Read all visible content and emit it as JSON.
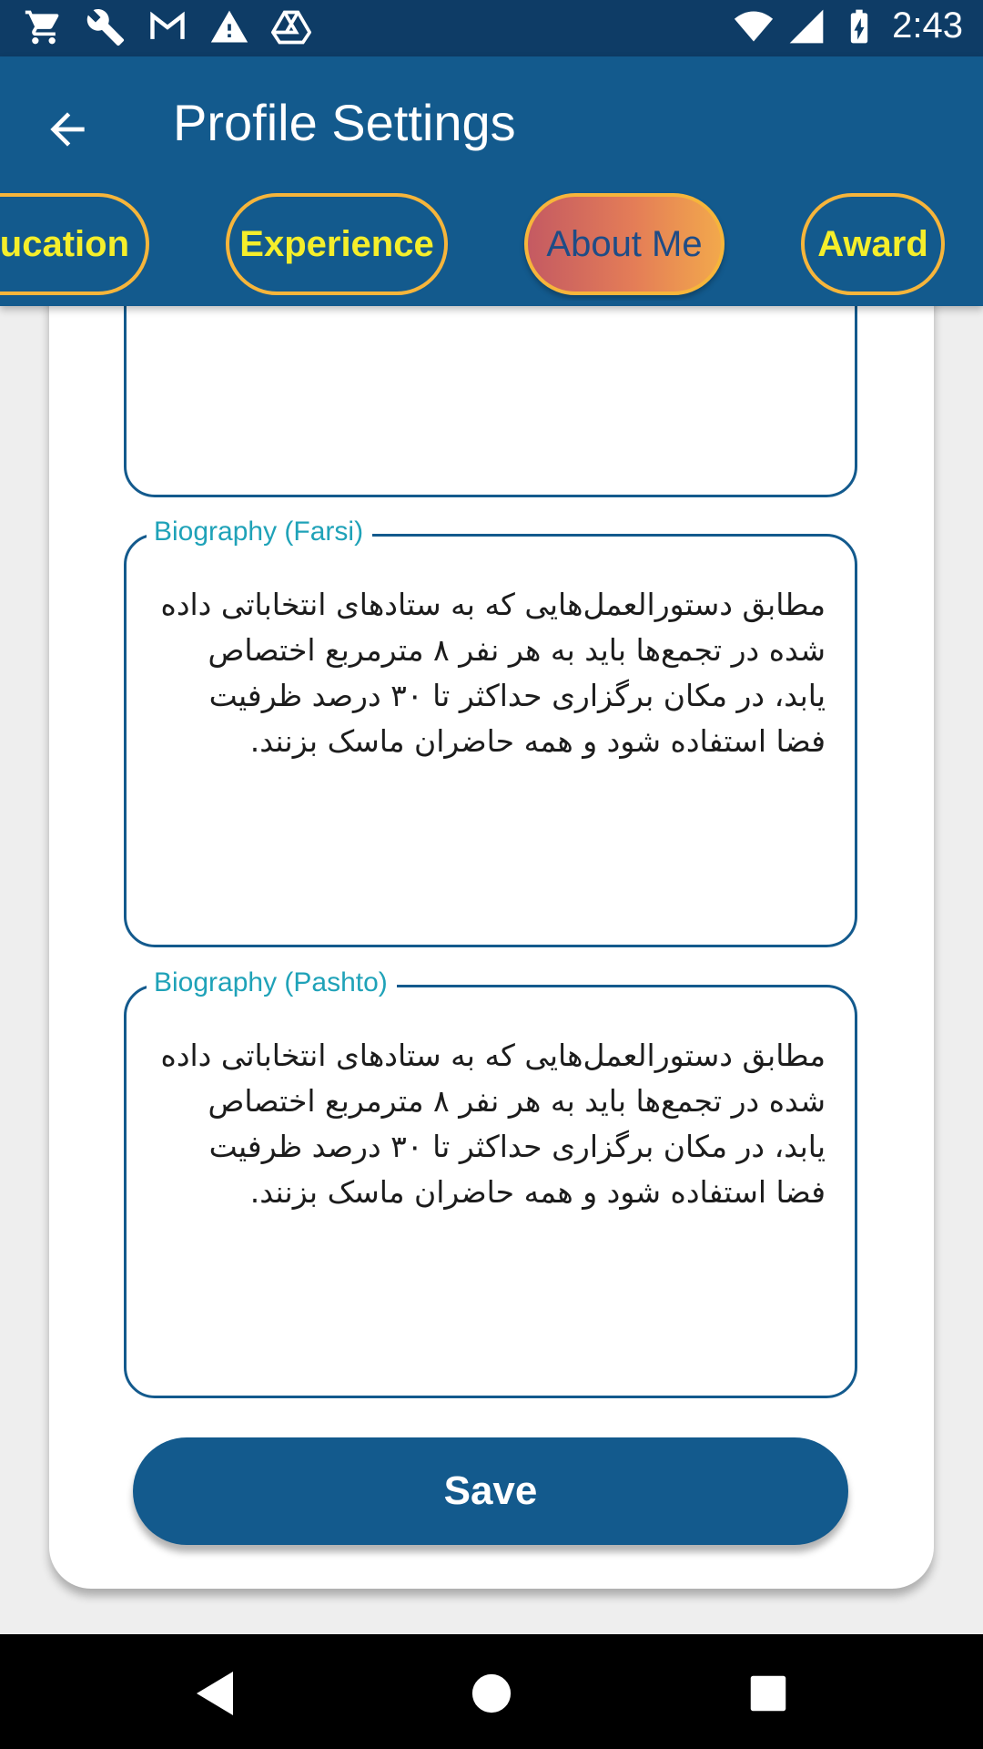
{
  "status_bar": {
    "time": "2:43",
    "notification_icons": [
      "cart-icon",
      "wrench-icon",
      "gmail-icon",
      "warning-icon",
      "drive-icon"
    ],
    "system_icons": [
      "wifi-icon",
      "signal-icon",
      "battery-charging-icon"
    ]
  },
  "app_bar": {
    "title": "Profile Settings",
    "back_icon": "arrow-left-icon",
    "background_color": "#135a8d"
  },
  "tabs": [
    {
      "label": "Education",
      "visible_text": "lucation",
      "active": false
    },
    {
      "label": "Experience",
      "active": false
    },
    {
      "label": "About Me",
      "active": true
    },
    {
      "label": "Award",
      "active": false
    }
  ],
  "form": {
    "fields": [
      {
        "label": "",
        "value": ""
      },
      {
        "label": "Biography (Farsi)",
        "value": "مطابق دستورالعمل‌هایی که به ستادهای انتخاباتی داده شده در تجمع‌ها باید به هر نفر ۸ مترمربع اختصاص یابد، در مکان برگزاری حداکثر تا ۳۰ درصد ظرفیت فضا استفاده شود و همه حاضران ماسک بزنند."
      },
      {
        "label": "Biography (Pashto)",
        "value": "مطابق دستورالعمل‌هایی که به ستادهای انتخاباتی داده شده در تجمع‌ها باید به هر نفر ۸ مترمربع اختصاص یابد، در مکان برگزاری حداکثر تا ۳۰ درصد ظرفیت فضا استفاده شود و همه حاضران ماسک بزنند."
      }
    ],
    "save_label": "Save"
  },
  "colors": {
    "primary": "#135a8d",
    "status_bar": "#0e3c66",
    "tab_border": "#f6b53b",
    "tab_text": "#f5ee2b",
    "label": "#1fa2b8"
  },
  "nav_bar": {
    "buttons": [
      "back-triangle-icon",
      "home-circle-icon",
      "recents-square-icon"
    ]
  }
}
